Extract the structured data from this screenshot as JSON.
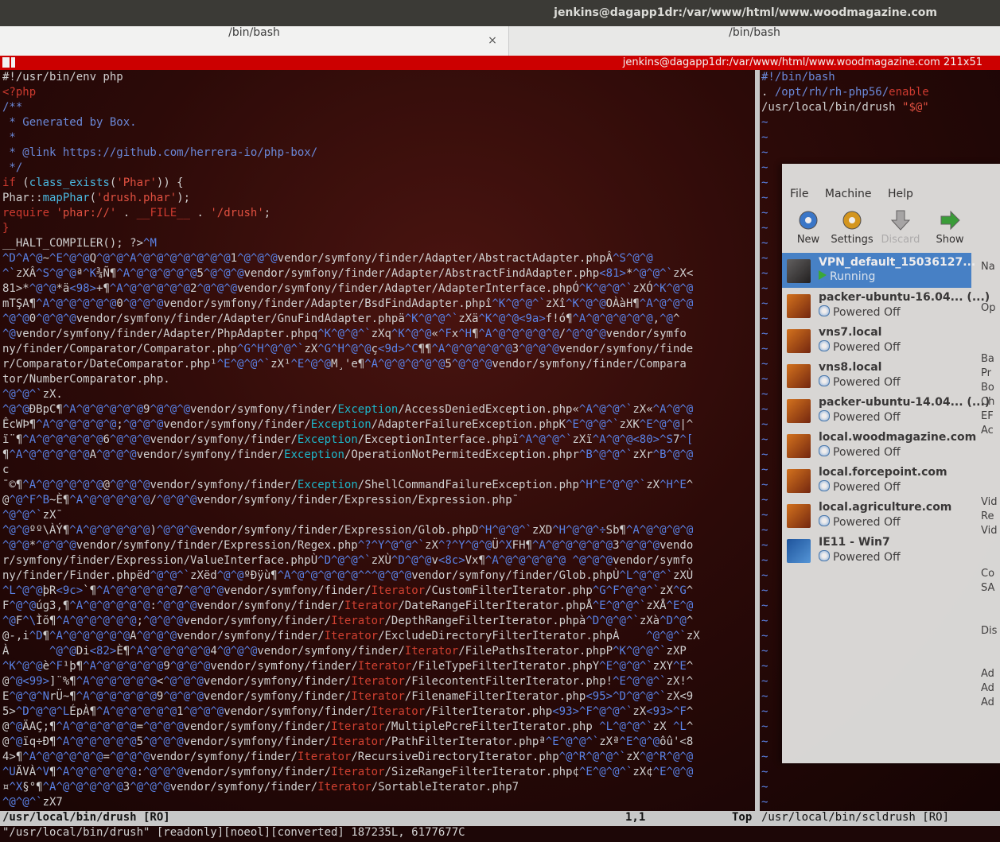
{
  "window_title": "jenkins@dagapp1dr:/var/www/html/www.woodmagazine.com",
  "tabs": [
    {
      "label": "/bin/bash"
    },
    {
      "label": "/bin/bash"
    }
  ],
  "tab_close_glyph": "×",
  "tmux_status": "jenkins@dagapp1dr:/var/www/html/www.woodmagazine.com 211x51",
  "left_lines": [
    "#!/usr/bin/env php",
    "<?php",
    "/**",
    " * Generated by Box.",
    " *",
    " * @link https://github.com/herrera-io/php-box/",
    " */",
    "if (class_exists('Phar')) {",
    "Phar::mapPhar('drush.phar');",
    "require 'phar://' . __FILE__ . '/drush';",
    "}",
    "__HALT_COMPILER(); ?>^M",
    "^D^A^@~^E^@^@Q^@^@^A^@^@^@^@^@^@^@1^@^@^@vendor/symfony/finder/Adapter/AbstractAdapter.phpÂ^S^@^@",
    "^`zXÂ^S^@^@ª^K¾Ñ¶^A^@^@^@^@^@5^@^@^@vendor/symfony/finder/Adapter/AbstractFindAdapter.php<81>*^@^@^`zX<",
    "81>*^@^@*ä<98>+¶^A^@^@^@^@^@2^@^@^@vendor/symfony/finder/Adapter/AdapterInterface.phpÓ^K^@^@^`zXÓ^K^@^@",
    "mTŞA¶^A^@^@^@^@^@0^@^@^@vendor/symfony/finder/Adapter/BsdFindAdapter.phpî^K^@^@^`zXî^K^@^@OÀàH¶^A^@^@^@",
    "^@^@0^@^@^@vendor/symfony/finder/Adapter/GnuFindAdapter.phpä^K^@^@^`zXä^K^@^@<9a>f!ó¶^A^@^@^@^@^@,^@^",
    "^@vendor/symfony/finder/Adapter/PhpAdapter.phpq^K^@^@^`zXq^K^@^@«^Fx^H¶^A^@^@^@^@^@/^@^@^@vendor/symfo",
    "ny/finder/Comparator/Comparator.php^G^H^@^@^`zX^G^H^@^@ç<9d>^C¶¶^A^@^@^@^@^@3^@^@^@vendor/symfony/finde",
    "r/Comparator/DateComparator.php¹^E^@^@^`zX¹^E^@^@M¸'e¶^A^@^@^@^@^@5^@^@^@vendor/symfony/finder/Compara",
    "tor/NumberComparator.php.",
    "^@^@^`zX.",
    "^@^@ÐBpC¶^A^@^@^@^@^@9^@^@^@vendor/symfony/finder/Exception/AccessDeniedException.php«^A^@^@^`zX«^A^@^@",
    "ÊcWÞ¶^A^@^@^@^@^@;^@^@^@vendor/symfony/finder/Exception/AdapterFailureException.phpK^E^@^@^`zXK^E^@^@|^",
    "ï¨¶^A^@^@^@^@^@6^@^@^@vendor/symfony/finder/Exception/ExceptionInterface.phpï^A^@^@^`zXï^A^@^@<80>^S7^[",
    "¶^A^@^@^@^@^@A^@^@^@vendor/symfony/finder/Exception/OperationNotPermitedException.phpr^B^@^@^`zXr^B^@^@",
    "c",
    "¯©¶^A^@^@^@^@^@@^@^@^@vendor/symfony/finder/Exception/ShellCommandFailureException.php^H^E^@^@^`zX^H^E^",
    "@^@^F^B~È¶^A^@^@^@^@^@/^@^@^@vendor/symfony/finder/Expression/Expression.php¯",
    "^@^@^`zX¯",
    "^@^@ºº\\ÀÝ¶^A^@^@^@^@^@)^@^@^@vendor/symfony/finder/Expression/Glob.phpD^H^@^@^`zXD^H^@^@^÷Sb¶^A^@^@^@^@",
    "^@^@*^@^@^@vendor/symfony/finder/Expression/Regex.php^?^Y^@^@^`zX^?^Y^@^@Ü^XFH¶^A^@^@^@^@^@3^@^@^@vendo",
    "r/symfony/finder/Expression/ValueInterface.phpÙ^D^@^@^`zXÙ^D^@^@v<8c>Vx¶^A^@^@^@^@^@ ^@^@^@vendor/symfo",
    "ny/finder/Finder.phpëd^@^@^`zXëd^@^@ºÐÿù¶^A^@^@^@^@^@^^^@^@^@vendor/symfony/finder/Glob.phpÙ^L^@^@^`zXÙ",
    "^L^@^@þR<9c>`¶^A^@^@^@^@^@7^@^@^@vendor/symfony/finder/Iterator/CustomFilterIterator.php^G^F^@^@^`zX^G^",
    "F^@^@úg3,¶^A^@^@^@^@^@:^@^@^@vendor/symfony/finder/Iterator/DateRangeFilterIterator.phpÅ^E^@^@^`zXÅ^E^@",
    "^@F^\\Ìõ¶^A^@^@^@^@^@;^@^@^@vendor/symfony/finder/Iterator/DepthRangeFilterIterator.phpà^D^@^@^`zXà^D^@^",
    "@-,i^D¶^A^@^@^@^@^@A^@^@^@vendor/symfony/finder/Iterator/ExcludeDirectoryFilterIterator.phpÀ    ^@^@^`zX",
    "À      ^@^@Di<82>È¶^A^@^@^@^@^@4^@^@^@vendor/symfony/finder/Iterator/FilePathsIterator.phpP^K^@^@^`zXP",
    "^K^@^@è^F¹þ¶^A^@^@^@^@^@9^@^@^@vendor/symfony/finder/Iterator/FileTypeFilterIterator.phpY^E^@^@^`zXY^E^",
    "@^@<99>]¨%¶^A^@^@^@^@^@<^@^@^@vendor/symfony/finder/Iterator/FilecontentFilterIterator.php!^E^@^@^`zX!^",
    "E^@^@^NrÜ~¶^A^@^@^@^@^@9^@^@^@vendor/symfony/finder/Iterator/FilenameFilterIterator.php<95>^D^@^@^`zX<9",
    "5>^D^@^@^LÉpÀ¶^A^@^@^@^@^@1^@^@^@vendor/symfony/finder/Iterator/FilterIterator.php<93>^F^@^@^`zX<93>^F^",
    "@^@ÄAÇ;¶^A^@^@^@^@^@=^@^@^@vendor/symfony/finder/Iterator/MultiplePcreFilterIterator.php ^L^@^@^`zX ^L^",
    "@^@ïq÷Ð¶^A^@^@^@^@^@5^@^@^@vendor/symfony/finder/Iterator/PathFilterIterator.phpª^E^@^@^`zXª^E^@^@ôû'<8",
    "4>¶^A^@^@^@^@^@=^@^@^@vendor/symfony/finder/Iterator/RecursiveDirectoryIterator.php^@^R^@^@^`zX^@^R^@^@",
    "^UÄVÀ^V¶^A^@^@^@^@^@:^@^@^@vendor/symfony/finder/Iterator/SizeRangeFilterIterator.php¢^E^@^@^`zX¢^E^@^@",
    "¤^X§°¶^A^@^@^@^@^@3^@^@^@vendor/symfony/finder/Iterator/SortableIterator.php7",
    "^@^@^`zX7"
  ],
  "right_lines": [
    "#!/bin/bash",
    ". /opt/rh/rh-php56/enable",
    "/usr/local/bin/drush \"$@\"",
    "~",
    "~",
    "~",
    "~",
    "~",
    "~",
    "~",
    "~",
    "~",
    "~",
    "~",
    "~",
    "~",
    "~",
    "~",
    "~",
    "~",
    "~",
    "~",
    "~",
    "~",
    "~",
    "~",
    "~",
    "~",
    "~",
    "~",
    "~",
    "~",
    "~",
    "~",
    "~",
    "~",
    "~",
    "~",
    "~",
    "~",
    "~",
    "~",
    "~",
    "~",
    "~",
    "~",
    "~",
    "~",
    "~",
    "~",
    "~",
    "~"
  ],
  "virtualbox": {
    "menus": [
      "File",
      "Machine",
      "Help"
    ],
    "toolbar": [
      {
        "label": "New",
        "icon": "new-gear-icon",
        "color": "#3c7fd6"
      },
      {
        "label": "Settings",
        "icon": "settings-gear-icon",
        "color": "#e0a020"
      },
      {
        "label": "Discard",
        "icon": "discard-arrow-icon",
        "color": "#b0b0b0"
      },
      {
        "label": "Show",
        "icon": "show-arrow-icon",
        "color": "#3ca83c"
      }
    ],
    "vms": [
      {
        "name": "VPN_default_15036127...",
        "status": "Running",
        "selected": true
      },
      {
        "name": "packer-ubuntu-16.04...",
        "suffix": "(...)",
        "status": "Powered Off"
      },
      {
        "name": "vns7.local",
        "status": "Powered Off"
      },
      {
        "name": "vns8.local",
        "status": "Powered Off"
      },
      {
        "name": "packer-ubuntu-14.04...",
        "suffix": "(...)",
        "status": "Powered Off"
      },
      {
        "name": "local.woodmagazine.com",
        "status": "Powered Off"
      },
      {
        "name": "local.forcepoint.com",
        "status": "Powered Off"
      },
      {
        "name": "local.agriculture.com",
        "status": "Powered Off"
      },
      {
        "name": "IE11 - Win7",
        "status": "Powered Off"
      }
    ],
    "right_panel_text": [
      "Na",
      "Op",
      "Ba",
      "Pr",
      "Bo",
      "Ch",
      "EF",
      "Ac",
      "Vid",
      "Re",
      "Vid",
      "Co",
      "SA",
      "Dis",
      "Ad",
      "Ad",
      "Ad"
    ]
  },
  "vim_status": {
    "left": "/usr/local/bin/drush [RO]",
    "position": "1,1",
    "scroll": "Top",
    "right": "/usr/local/bin/scldrush [RO]"
  },
  "cmdline": "\"/usr/local/bin/drush\" [readonly][noeol][converted] 187235L, 6177677C"
}
